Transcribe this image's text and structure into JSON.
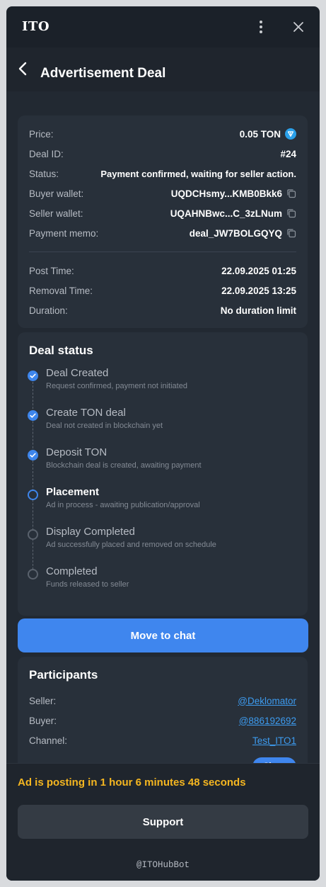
{
  "app": {
    "title": "ITO"
  },
  "header": {
    "title": "Advertisement Deal"
  },
  "deal": {
    "price_label": "Price:",
    "price_value": "0.05 TON",
    "id_label": "Deal ID:",
    "id_value": "#24",
    "status_label": "Status:",
    "status_value": "Payment confirmed, waiting for seller action.",
    "buyer_wallet_label": "Buyer wallet:",
    "buyer_wallet_value": "UQDCHsmy...KMB0Bkk6",
    "seller_wallet_label": "Seller wallet:",
    "seller_wallet_value": "UQAHNBwc...C_3zLNum",
    "memo_label": "Payment memo:",
    "memo_value": "deal_JW7BOLGQYQ",
    "post_time_label": "Post Time:",
    "post_time_value": "22.09.2025 01:25",
    "removal_time_label": "Removal Time:",
    "removal_time_value": "22.09.2025 13:25",
    "duration_label": "Duration:",
    "duration_value": "No duration limit"
  },
  "deal_status": {
    "title": "Deal status",
    "steps": [
      {
        "title": "Deal Created",
        "subtitle": "Request confirmed, payment not initiated",
        "state": "done"
      },
      {
        "title": "Create TON deal",
        "subtitle": "Deal not created in blockchain yet",
        "state": "done"
      },
      {
        "title": "Deposit TON",
        "subtitle": "Blockchain deal is created, awaiting payment",
        "state": "done"
      },
      {
        "title": "Placement",
        "subtitle": "Ad in process - awaiting publication/approval",
        "state": "active"
      },
      {
        "title": "Display Completed",
        "subtitle": "Ad successfully placed and removed on schedule",
        "state": "pending"
      },
      {
        "title": "Completed",
        "subtitle": "Funds released to seller",
        "state": "pending"
      }
    ]
  },
  "actions": {
    "move_to_chat": "Move to chat"
  },
  "participants": {
    "title": "Participants",
    "seller_label": "Seller:",
    "seller_value": "@Deklomator",
    "buyer_label": "Buyer:",
    "buyer_value": "@886192692",
    "channel_label": "Channel:",
    "channel_value": "Test_ITO1",
    "show_label": "Show"
  },
  "footer": {
    "countdown": "Ad is posting in 1 hour 6 minutes 48 seconds",
    "support_label": "Support",
    "bot_name": "@ITOHubBot"
  },
  "colors": {
    "accent": "#3f86ee",
    "warning": "#f5b620",
    "ton": "#2aa0e9",
    "background": "#1b2129"
  },
  "icons": [
    "more-vertical-icon",
    "close-icon",
    "back-arrow-icon",
    "ton-icon",
    "copy-icon",
    "check-icon"
  ]
}
